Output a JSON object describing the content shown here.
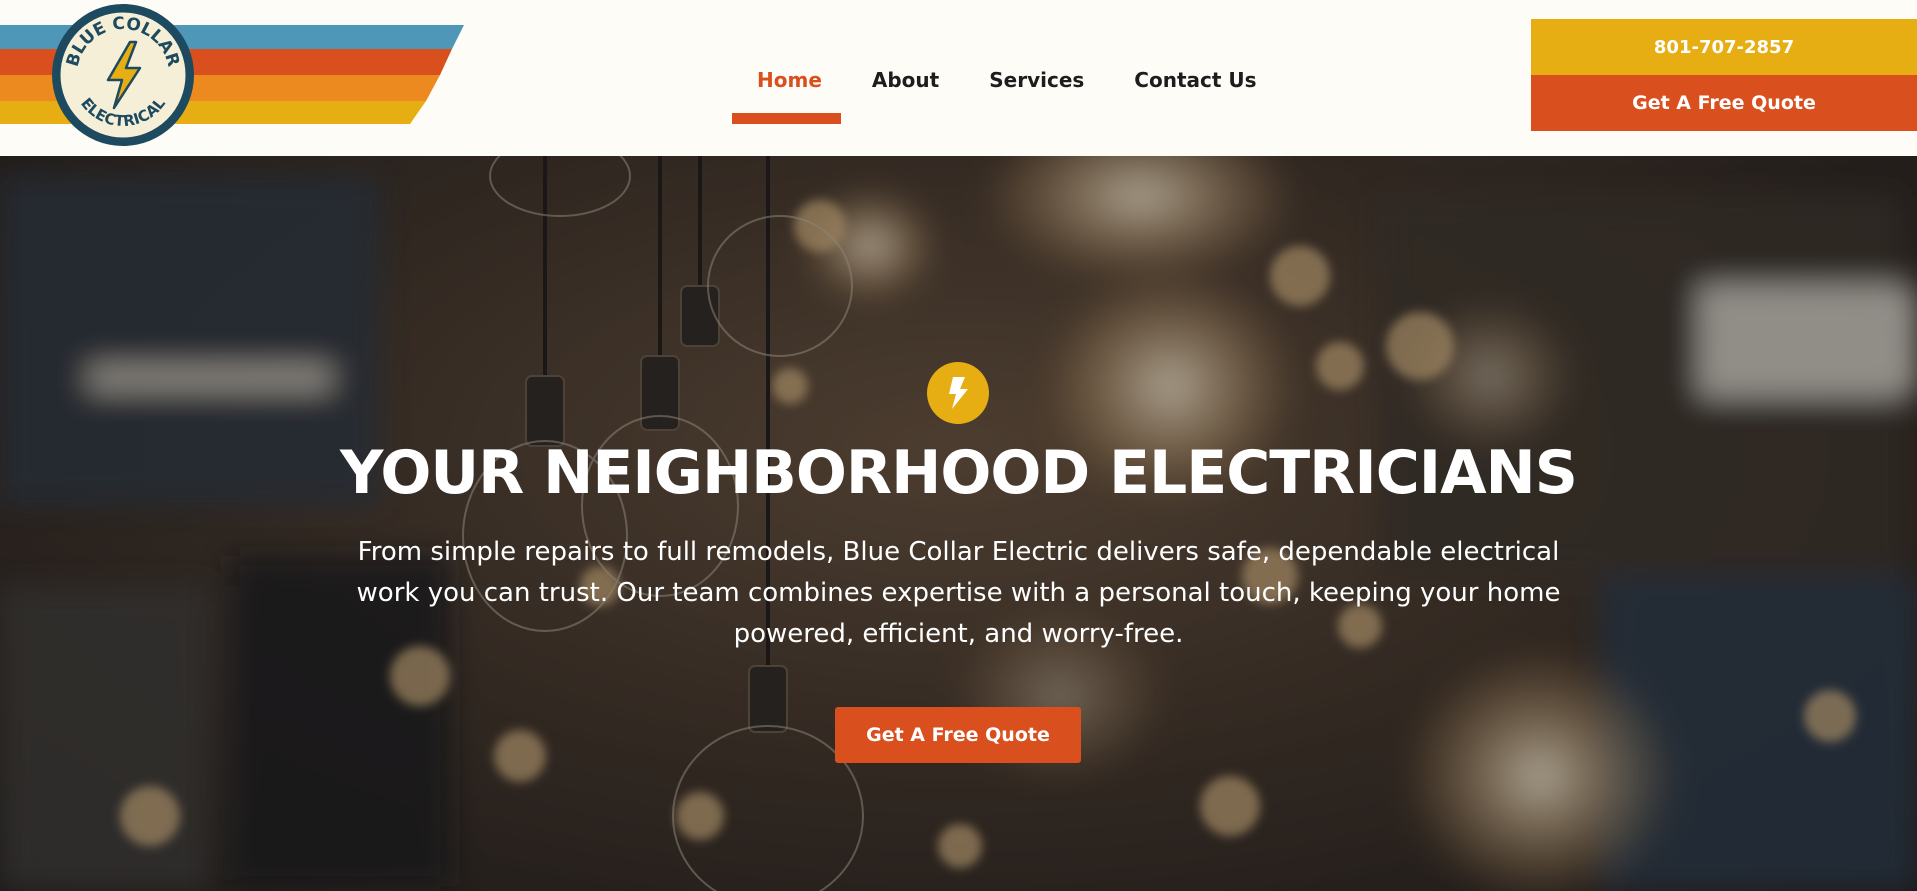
{
  "brand": {
    "logo_icon": "lightning-bolt-icon",
    "logo_text": "BLUE COLLAR ELECTRICAL",
    "stripe_colors": [
      "#4e97b8",
      "#d9501e",
      "#ed8a1f",
      "#e6ae12"
    ],
    "ring_color": "#1d4a5f",
    "accent_color": "#d9501e"
  },
  "nav": {
    "items": [
      {
        "label": "Home",
        "active": true
      },
      {
        "label": "About",
        "active": false
      },
      {
        "label": "Services",
        "active": false
      },
      {
        "label": "Contact Us",
        "active": false
      }
    ]
  },
  "header_cta": {
    "phone": "801-707-2857",
    "quote_label": "Get A Free Quote",
    "phone_color": "#e6ae12",
    "quote_color": "#d9501e"
  },
  "hero": {
    "icon": "lightning-bolt-icon",
    "title": "YOUR NEIGHBORHOOD ELECTRICIANS",
    "text_line_1": "From simple repairs to full remodels, Blue Collar Electric delivers safe, dependable electrical",
    "text_line_2": "work you can trust. Our team combines expertise with a personal touch, keeping your home",
    "text_line_3": "powered, efficient, and worry-free.",
    "button_label": "Get A Free Quote",
    "background": "blurred hanging edison light bulbs"
  }
}
